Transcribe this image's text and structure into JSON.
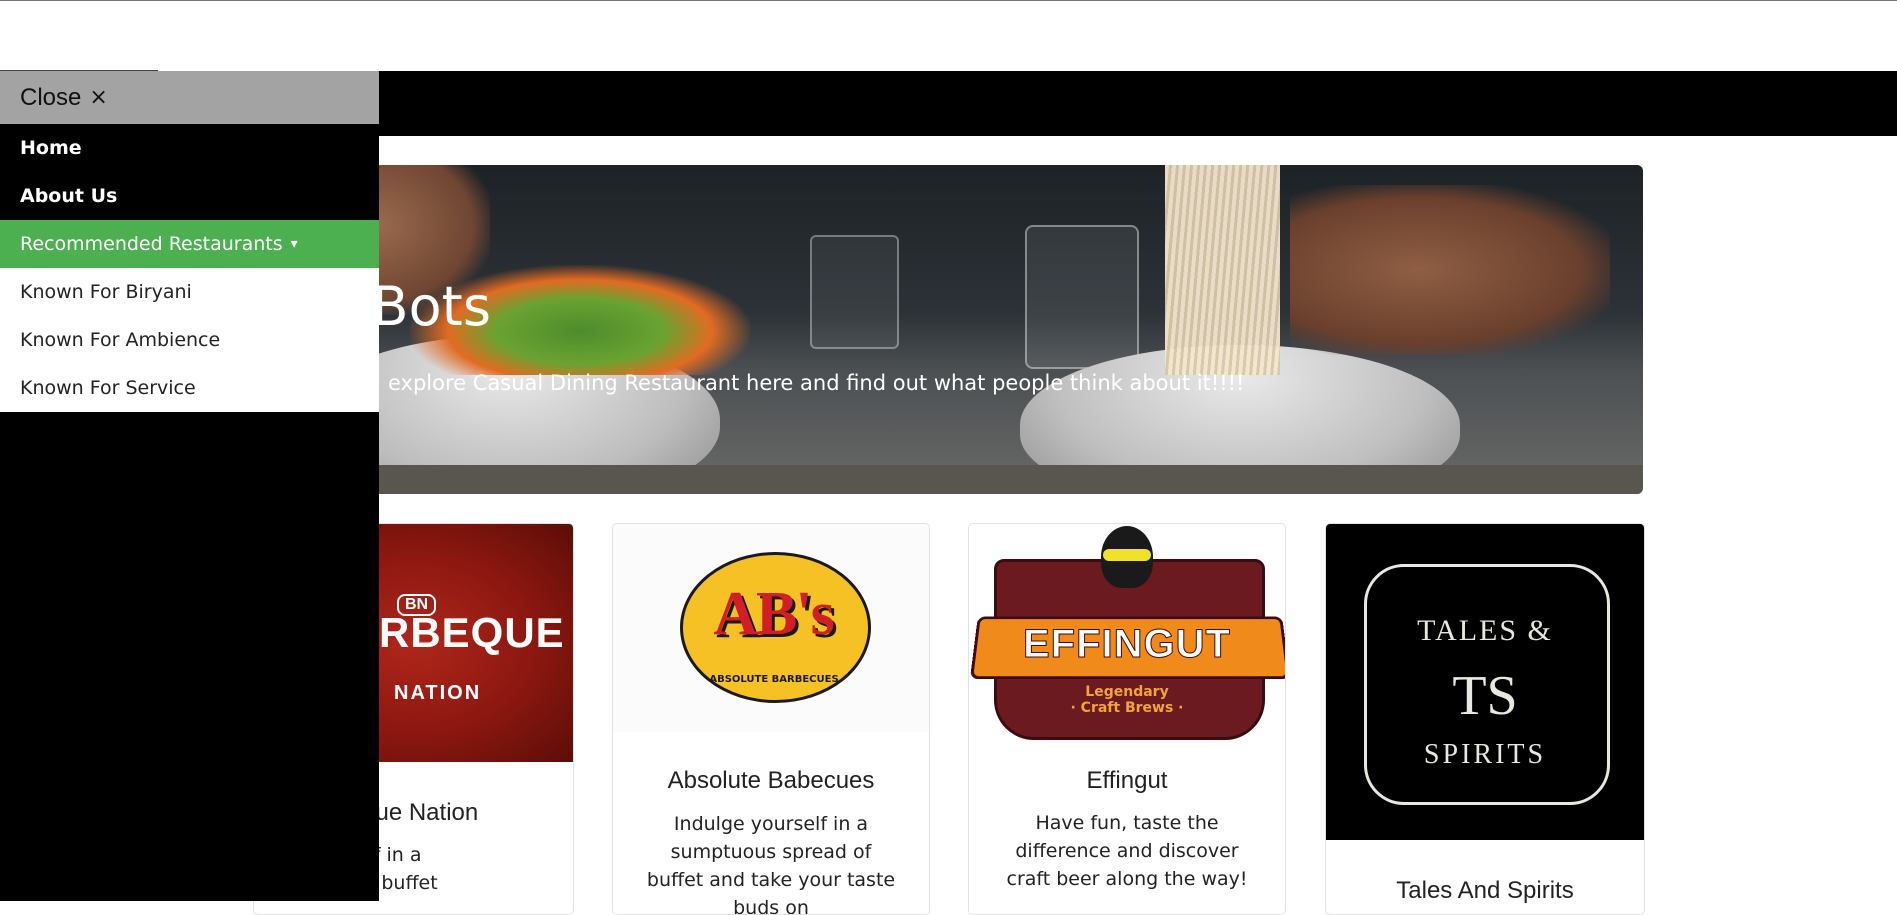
{
  "sidebar": {
    "close_label": "Close",
    "close_icon": "×",
    "items": [
      {
        "label": "Home"
      },
      {
        "label": "About Us"
      },
      {
        "label": "Recommended Restaurants",
        "caret": "▾"
      }
    ],
    "dropdown": [
      {
        "label": "Known For Biryani"
      },
      {
        "label": "Known For Ambience"
      },
      {
        "label": "Known For Service"
      }
    ],
    "active_color": "#4caf50"
  },
  "hero": {
    "title_visible": "te Bots",
    "subtitle_visible": "explore Casual Dining Restaurant here and find out what people think about it!!!!"
  },
  "cards": [
    {
      "title_visible": "eque Nation",
      "desc_visible": [
        "e yourself in a",
        "s spread of buffet"
      ],
      "logo": {
        "badge": "BN",
        "line1": "RBEQUE",
        "line2": "NATION"
      }
    },
    {
      "title": "Absolute Babecues",
      "desc": "Indulge yourself in a sumptuous spread of buffet and take your taste buds on",
      "logo": {
        "main": "AB's",
        "tiny": "ABSOLUTE BARBECUES"
      }
    },
    {
      "title": "Effingut",
      "desc": "Have fun, taste the difference and discover craft beer along the way!",
      "logo": {
        "main": "EFFINGUT",
        "tag1": "Legendary",
        "tag2": "· Craft Brews ·"
      }
    },
    {
      "title": "Tales And Spirits",
      "logo": {
        "line1": "TALES &",
        "mono": "TS",
        "line2": "SPIRITS"
      }
    }
  ]
}
